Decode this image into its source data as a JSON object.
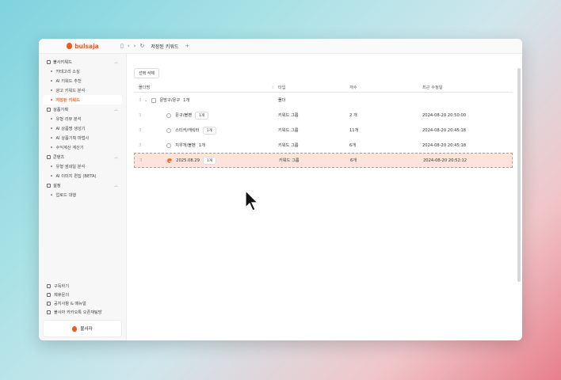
{
  "titlebar": {
    "brand": "bulsaja",
    "tab_title": "저장된 키워드",
    "tab_plus": "+"
  },
  "sidebar": {
    "sections": [
      {
        "title": "불사키워드",
        "items": [
          "카테고리 소싱",
          "AI 키워드 추천",
          "광고 키워드 분석",
          "저장된 키워드"
        ]
      },
      {
        "title": "상품기획",
        "items": [
          "유형 리뷰 분석",
          "AI 상품명 생성기",
          "AI 상품기획 마법사",
          "수익계산 계산기"
        ]
      },
      {
        "title": "콘텐츠",
        "items": [
          "유형 썸네일 분석",
          "AI 이미지 편집 (BETA)"
        ]
      },
      {
        "title": "설정",
        "items": [
          "업로드 대행"
        ]
      }
    ],
    "utilities": [
      "구독하기",
      "제휴문의",
      "공지사항 & 매뉴얼",
      "불사자 카카오톡 오픈채팅방"
    ],
    "user_label": "불사자"
  },
  "main": {
    "select_delete": "선택 삭제",
    "columns": [
      "폴더명",
      "타입",
      "개수",
      "최근 수정일"
    ],
    "rows": [
      {
        "name": "문방구/문구",
        "badge": "1개",
        "type": "폴더",
        "count": "",
        "date": ""
      },
      {
        "name": "문구/볼펜",
        "badge": "1개",
        "type": "키워드 그룹",
        "count": "2 개",
        "date": "2024-08-20 20:50:00"
      },
      {
        "name": "스티커/캐릭터",
        "badge": "1개",
        "type": "키워드 그룹",
        "count": "11개",
        "date": "2024-08-20 20:45:18"
      },
      {
        "name": "지우개/볼펜",
        "badge": "1개",
        "type": "키워드 그룹",
        "count": "6개",
        "date": "2024-08-20 20:45:18"
      },
      {
        "name": "2025.08.29",
        "badge": "1개",
        "type": "키워드 그룹",
        "count": "6개",
        "date": "2024-08-20 20:52:12"
      }
    ]
  },
  "icons": {
    "sidebar_toggle": "sidebar-icon",
    "back": "chevron-left-icon",
    "forward": "chevron-right-icon",
    "refresh": "refresh-icon"
  },
  "colors": {
    "accent": "#ef6b2f",
    "highlight": "#fde3dc"
  }
}
